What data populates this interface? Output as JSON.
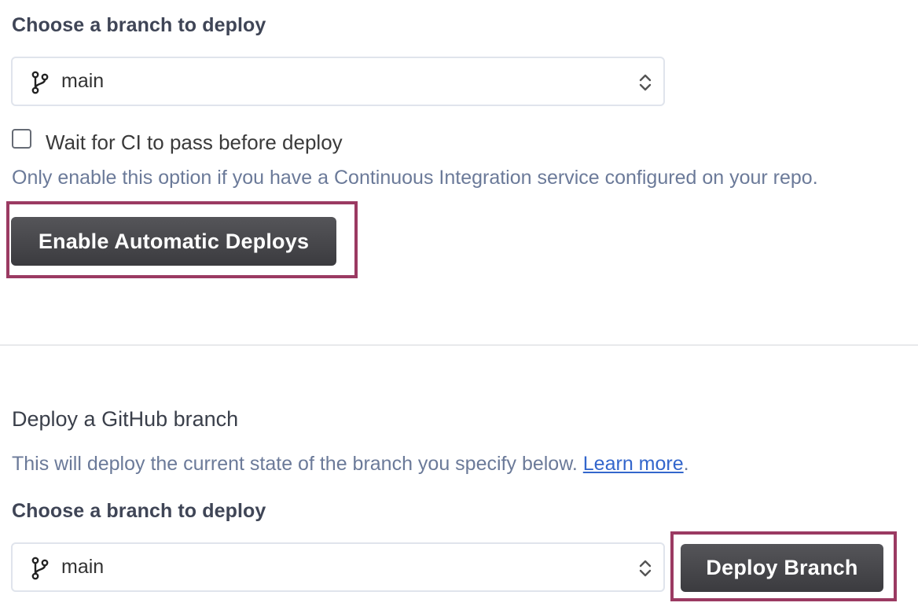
{
  "auto_deploy": {
    "label": "Choose a branch to deploy",
    "branch_select": {
      "value": "main",
      "icon": "git-branch-icon"
    },
    "wait_ci_checkbox": {
      "checked": false,
      "label": "Wait for CI to pass before deploy"
    },
    "hint": "Only enable this option if you have a Continuous Integration service configured on your repo.",
    "enable_button": "Enable Automatic Deploys"
  },
  "manual_deploy": {
    "heading": "Deploy a GitHub branch",
    "description": "This will deploy the current state of the branch you specify below.",
    "learn_more": "Learn more",
    "period": ".",
    "label": "Choose a branch to deploy",
    "branch_select": {
      "value": "main",
      "icon": "git-branch-icon"
    },
    "deploy_button": "Deploy Branch"
  },
  "colors": {
    "button": "#47474b",
    "highlight": "#9b3a62",
    "link": "#3366cc",
    "hint_text": "#6b7a99"
  }
}
